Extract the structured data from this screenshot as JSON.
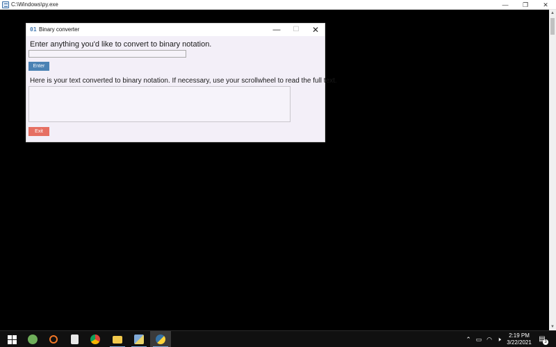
{
  "console_window": {
    "title": "C:\\Windows\\py.exe",
    "controls": {
      "minimize": "—",
      "restore": "❐",
      "close": "✕"
    }
  },
  "app_window": {
    "icon_text": "01",
    "title": "Binary converter",
    "controls": {
      "minimize": "—",
      "maximize": "☐",
      "close": "✕"
    },
    "prompt_label": "Enter anything you'd like to convert to binary notation.",
    "input": {
      "value": "",
      "placeholder": ""
    },
    "enter_button": "Enter",
    "output_label": "Here is your text converted to binary notation. If necessary, use your scrollwheel to read the full text.",
    "output_text": "",
    "exit_button": "Exit",
    "colors": {
      "enter": "#4b82b4",
      "exit": "#e66f62",
      "background": "#f3eff8"
    }
  },
  "taskbar": {
    "apps": [
      {
        "name": "start-button-icon",
        "color": "#ffffff"
      },
      {
        "name": "recycle-app-icon",
        "color": "#6fae5a"
      },
      {
        "name": "jupyter-icon",
        "color": "#f37726"
      },
      {
        "name": "document-app-icon",
        "color": "#e8e8e8"
      },
      {
        "name": "chrome-icon",
        "color": "#db4437"
      },
      {
        "name": "file-explorer-icon",
        "color": "#f2c94c"
      },
      {
        "name": "python-idle-icon",
        "color": "#7fa9d8"
      },
      {
        "name": "python-icon",
        "color": "#3572a5"
      }
    ],
    "tray": {
      "chevron": "⌃",
      "wifi": "◠",
      "volume": "🕨"
    },
    "clock": {
      "time": "2:19 PM",
      "date": "3/22/2021"
    },
    "notification_count": "3"
  }
}
